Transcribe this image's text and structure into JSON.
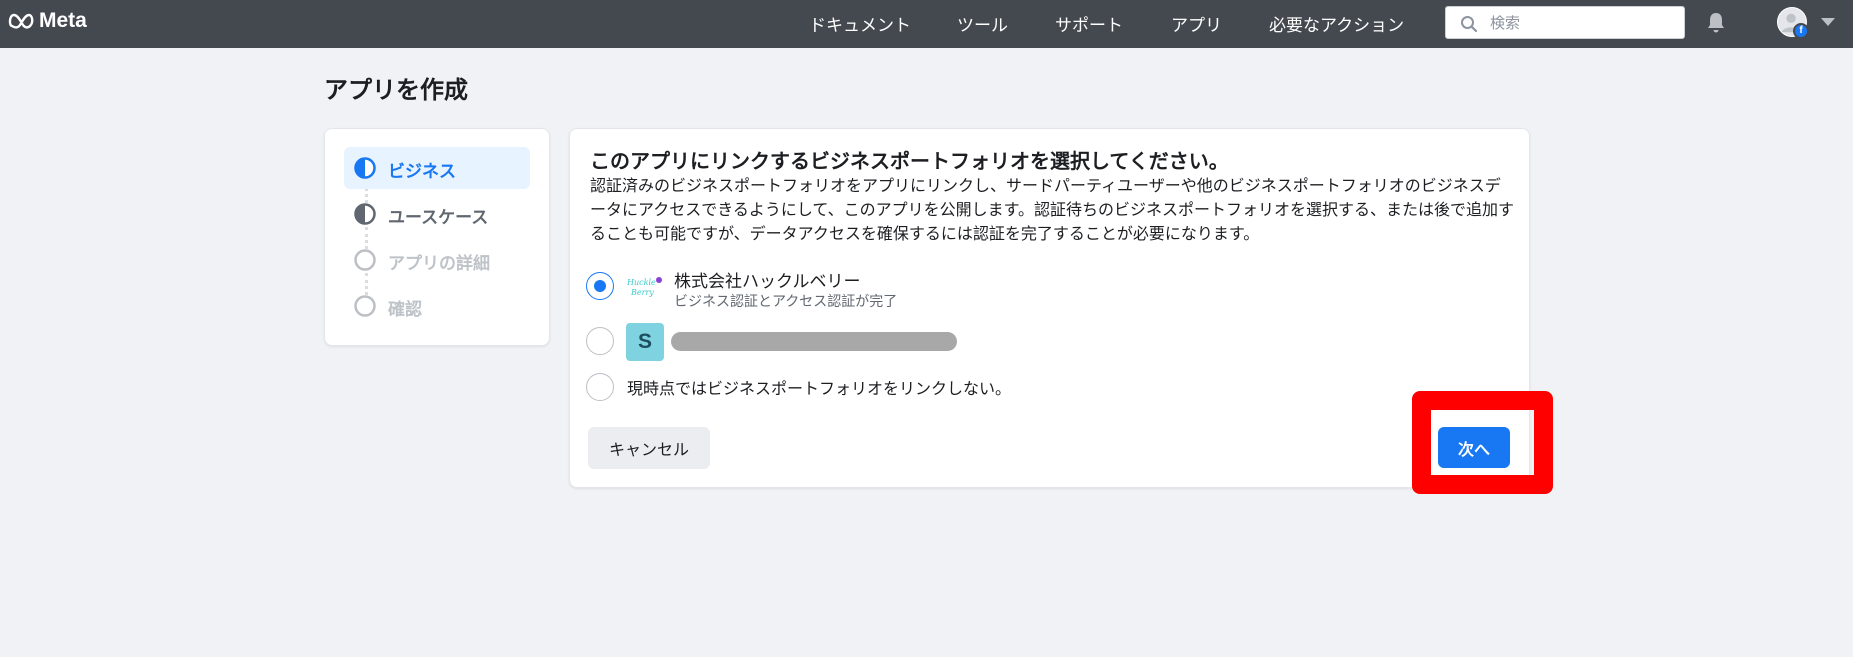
{
  "topbar": {
    "brand": "Meta",
    "nav": [
      "ドキュメント",
      "ツール",
      "サポート",
      "アプリ",
      "必要なアクション"
    ],
    "search_placeholder": "検索",
    "avatar_badge": "f"
  },
  "page": {
    "title": "アプリを作成"
  },
  "steps": [
    {
      "label": "ビジネス",
      "state": "active"
    },
    {
      "label": "ユースケース",
      "state": "done"
    },
    {
      "label": "アプリの詳細",
      "state": "todo"
    },
    {
      "label": "確認",
      "state": "todo"
    }
  ],
  "card": {
    "title": "このアプリにリンクするビジネスポートフォリオを選択してください。",
    "description": "認証済みのビジネスポートフォリオをアプリにリンクし、サードパーティユーザーや他のビジネスポートフォリオのビジネスデータにアクセスできるようにして、このアプリを公開します。認証待ちのビジネスポートフォリオを選択する、または後で追加することも可能ですが、データアクセスを確保するには認証を完了することが必要になります。",
    "options": [
      {
        "name": "株式会社ハックルベリー",
        "subtitle": "ビジネス認証とアクセス認証が完了",
        "selected": true
      },
      {
        "avatar_letter": "S",
        "selected": false
      },
      {
        "name": "現時点ではビジネスポートフォリオをリンクしない。",
        "selected": false
      }
    ],
    "cancel_label": "キャンセル",
    "next_label": "次へ"
  },
  "colors": {
    "accent": "#1877f2",
    "highlight": "#ff0000",
    "topbar": "#444950"
  }
}
